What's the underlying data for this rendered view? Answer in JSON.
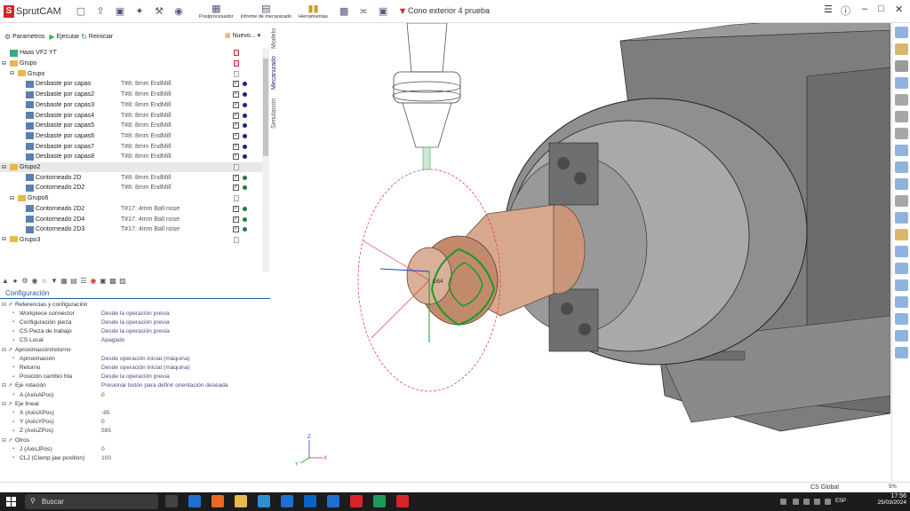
{
  "app": {
    "logo_text": "SprutCAM",
    "doc_title": "Cono exterior 4 prueba",
    "toolbar_labels": {
      "postprocesador": "Postprocesador",
      "informe": "Informe de mecanizado",
      "herramientas": "Herramientas"
    }
  },
  "op_toolbar": {
    "parametros": "Parametros",
    "ejecutar": "Ejecutar",
    "reiniciar": "Reiniciar",
    "nuevo": "Nuevo..."
  },
  "side_tabs": [
    "Modelo",
    "Mecanizado",
    "Simulación"
  ],
  "tree": [
    {
      "name": "Haas VF2 YT",
      "tool": "",
      "kind": "machine",
      "depth": 0
    },
    {
      "name": "Grupo",
      "tool": "",
      "kind": "folder",
      "depth": 0
    },
    {
      "name": "Grupo",
      "tool": "",
      "kind": "folder",
      "depth": 1
    },
    {
      "name": "Desbaste por capas",
      "tool": "T#8: 8mm EndMill",
      "kind": "op",
      "depth": 2
    },
    {
      "name": "Desbaste por capas2",
      "tool": "T#8: 8mm EndMill",
      "kind": "op",
      "depth": 2
    },
    {
      "name": "Desbaste por capas3",
      "tool": "T#8: 8mm EndMill",
      "kind": "op",
      "depth": 2
    },
    {
      "name": "Desbaste por capas4",
      "tool": "T#8: 8mm EndMill",
      "kind": "op",
      "depth": 2
    },
    {
      "name": "Desbaste por capas5",
      "tool": "T#8: 8mm EndMill",
      "kind": "op",
      "depth": 2
    },
    {
      "name": "Desbaste por capas6",
      "tool": "T#8: 8mm EndMill",
      "kind": "op",
      "depth": 2
    },
    {
      "name": "Desbaste por capas7",
      "tool": "T#8: 8mm EndMill",
      "kind": "op",
      "depth": 2
    },
    {
      "name": "Desbaste por capas8",
      "tool": "T#8: 8mm EndMill",
      "kind": "op",
      "depth": 2
    },
    {
      "name": "Grupo2",
      "tool": "",
      "kind": "folder",
      "depth": 0
    },
    {
      "name": "Contorneado 2D",
      "tool": "T#8: 8mm EndMill",
      "kind": "op",
      "depth": 2
    },
    {
      "name": "Contorneado 2D2",
      "tool": "T#8: 8mm EndMill",
      "kind": "op",
      "depth": 2
    },
    {
      "name": "Grupo6",
      "tool": "",
      "kind": "folder",
      "depth": 1
    },
    {
      "name": "Contorneado 2D2",
      "tool": "T#17: 4mm Ball nose",
      "kind": "op",
      "depth": 2
    },
    {
      "name": "Contorneado 2D4",
      "tool": "T#17: 4mm Ball nose",
      "kind": "op",
      "depth": 2
    },
    {
      "name": "Contorneado 2D3",
      "tool": "T#17: 4mm Ball nose",
      "kind": "op",
      "depth": 2
    },
    {
      "name": "Grupo3",
      "tool": "",
      "kind": "folder",
      "depth": 0
    }
  ],
  "config": {
    "title": "Configuración",
    "rows": [
      {
        "name": "Referencias y configuración",
        "value": "",
        "depth": 0,
        "group": true
      },
      {
        "name": "Workpiece connector",
        "value": "Desde la operación previa",
        "depth": 1
      },
      {
        "name": "Configuración pieza",
        "value": "Desde la operación previa",
        "depth": 1
      },
      {
        "name": "CS Pieza de trabajo",
        "value": "Desde la operación previa",
        "depth": 1
      },
      {
        "name": "CS Local",
        "value": "Apagado",
        "depth": 1
      },
      {
        "name": "Aproximación/retorno",
        "value": "",
        "depth": 0,
        "group": true
      },
      {
        "name": "Aproximación",
        "value": "Desde operación inicial (máquina)",
        "depth": 1
      },
      {
        "name": "Retorno",
        "value": "Desde operación inicial (máquina)",
        "depth": 1
      },
      {
        "name": "Posición cambio hta",
        "value": "Desde la operación previa",
        "depth": 1
      },
      {
        "name": "Eje rotación",
        "value": "Presionar botón para definir orientación deseada",
        "depth": 0,
        "group": true
      },
      {
        "name": "A (AxisAPos)",
        "value": "0",
        "depth": 1,
        "num": true
      },
      {
        "name": "Eje lineal",
        "value": "",
        "depth": 0,
        "group": true
      },
      {
        "name": "X (AxisXPos)",
        "value": "-85",
        "depth": 1,
        "num": true
      },
      {
        "name": "Y (AxisYPos)",
        "value": "0",
        "depth": 1,
        "num": true
      },
      {
        "name": "Z (AxisZPos)",
        "value": "585",
        "depth": 1,
        "num": true
      },
      {
        "name": "Otros",
        "value": "",
        "depth": 0,
        "group": true
      },
      {
        "name": "J (AxisJPos)",
        "value": "0",
        "depth": 1,
        "num": true
      },
      {
        "name": "CLJ (Clamp jaw position)",
        "value": "100",
        "depth": 1,
        "num": true
      }
    ]
  },
  "viewport": {
    "label_g54": "G54",
    "axis_x": "X",
    "axis_y": "Y",
    "axis_z": "Z"
  },
  "status": {
    "cs": "CS Global",
    "zoom": "5%"
  },
  "taskbar": {
    "search": "Buscar",
    "lang": "ESP",
    "time": "17:56",
    "date": "25/03/2024"
  },
  "colors": {
    "accent_blue": "#1c5aa6",
    "brand_red": "#d8232a",
    "dot_navy": "#1a237e",
    "dot_green": "#1b7d3a"
  }
}
